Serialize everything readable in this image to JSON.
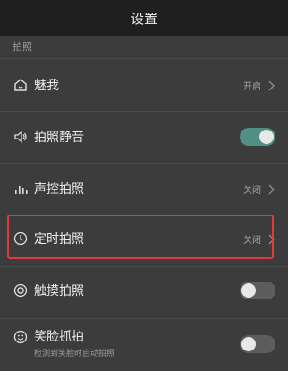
{
  "header": {
    "title": "设置"
  },
  "section": {
    "label": "拍照"
  },
  "rows": [
    {
      "id": "meiwo",
      "label": "魅我",
      "value": "开启",
      "control": "chevron",
      "icon": "home-face-icon"
    },
    {
      "id": "mute",
      "label": "拍照静音",
      "control": "toggle",
      "state": "on",
      "icon": "speaker-icon"
    },
    {
      "id": "voice",
      "label": "声控拍照",
      "value": "关闭",
      "control": "chevron",
      "icon": "sound-bars-icon"
    },
    {
      "id": "timer",
      "label": "定时拍照",
      "value": "关闭",
      "control": "chevron",
      "icon": "clock-icon",
      "highlighted": true
    },
    {
      "id": "touch",
      "label": "触摸拍照",
      "control": "toggle",
      "state": "off",
      "icon": "touch-circle-icon"
    },
    {
      "id": "smile",
      "label": "笑脸抓拍",
      "sublabel": "检测到笑脸时自动拍照",
      "control": "toggle",
      "state": "off",
      "icon": "smile-icon"
    }
  ],
  "colors": {
    "background": "#3c3c3c",
    "header": "#1f1f1f",
    "toggle_on": "#4f8f86",
    "highlight": "#e23a3a"
  }
}
